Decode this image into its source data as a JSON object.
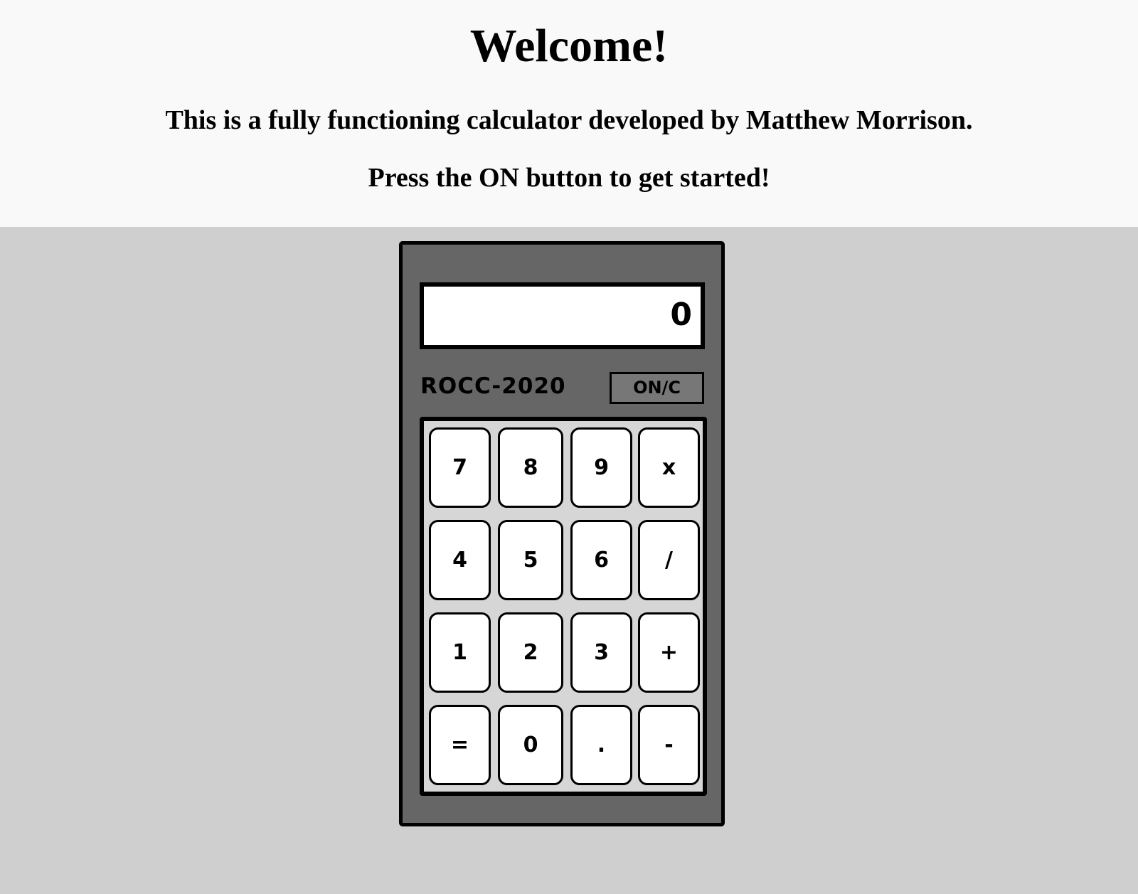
{
  "header": {
    "title": "Welcome!",
    "line1": "This is a fully functioning calculator developed by Matthew Morrison.",
    "line2": "Press the ON button to get started!"
  },
  "calculator": {
    "display_value": "0",
    "brand": "ROCC-2020",
    "on_label": "ON/C",
    "keys": {
      "k7": "7",
      "k8": "8",
      "k9": "9",
      "multiply": "x",
      "k4": "4",
      "k5": "5",
      "k6": "6",
      "divide": "/",
      "k1": "1",
      "k2": "2",
      "k3": "3",
      "plus": "+",
      "equals": "=",
      "k0": "0",
      "decimal": ".",
      "minus": "-"
    }
  },
  "colors": {
    "header_bg": "#f9f9f9",
    "page_bg": "#cfcfcf",
    "calc_body": "#666666",
    "on_button": "#777777",
    "keypad_bg": "#d6d6d6"
  }
}
